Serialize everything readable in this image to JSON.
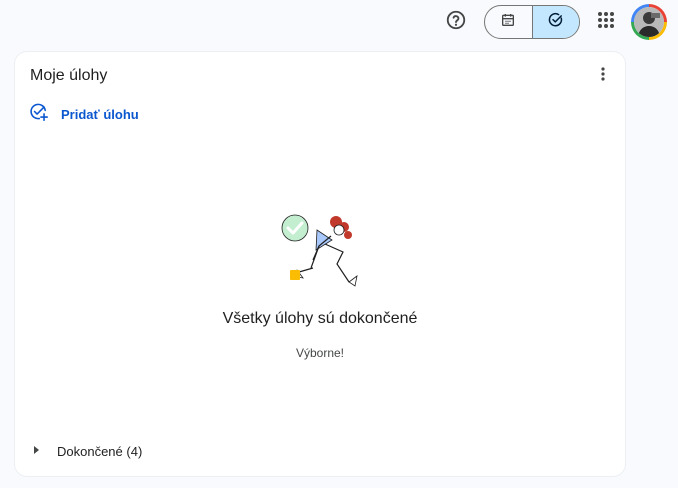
{
  "topbar": {
    "help_icon": "help-circle-icon",
    "view_toggle": [
      {
        "icon": "calendar-icon",
        "active": false
      },
      {
        "icon": "task-check-icon",
        "active": true
      }
    ],
    "apps_icon": "apps-grid-icon",
    "accent": "#c2e7ff"
  },
  "tasks_panel": {
    "title": "Moje úlohy",
    "add_task_label": "Pridať úlohu",
    "empty_title": "Všetky úlohy sú dokončené",
    "empty_subtitle": "Výborne!",
    "completed_label": "Dokončené (4)",
    "accent": "#0b57d0"
  }
}
